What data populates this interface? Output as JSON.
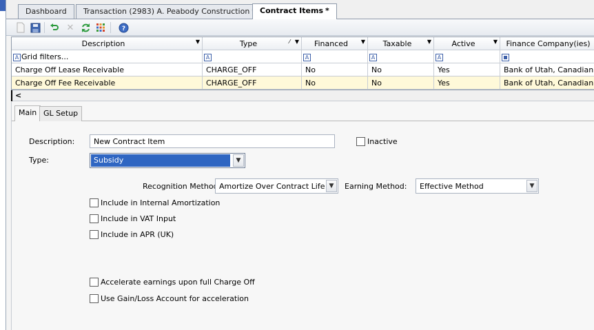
{
  "tabs": [
    {
      "label": "Dashboard",
      "dirty": ""
    },
    {
      "label": "Transaction (2983) A. Peabody Construction",
      "dirty": "*"
    },
    {
      "label": "Contract Items",
      "dirty": "*"
    }
  ],
  "toolbar": {
    "buttons": [
      "new-icon",
      "save-icon",
      "undo-icon",
      "delete-icon",
      "refresh-icon",
      "grid-icon",
      "help-icon"
    ]
  },
  "grid": {
    "columns": [
      "Description",
      "Type",
      "Financed",
      "Taxable",
      "Active",
      "Finance Company(ies)"
    ],
    "filter_placeholder": "Grid filters...",
    "rows": [
      [
        "Charge Off Lease Receivable",
        "CHARGE_OFF",
        "No",
        "No",
        "Yes",
        "Bank of Utah, Canadian Co"
      ],
      [
        "Charge Off Fee Receivable",
        "CHARGE_OFF",
        "No",
        "No",
        "Yes",
        "Bank of Utah, Canadian Co"
      ]
    ],
    "scroll_left": "<"
  },
  "form": {
    "tabs": [
      "Main",
      "GL Setup"
    ],
    "description_label": "Description:",
    "description_value": "New Contract Item",
    "inactive_label": "Inactive",
    "type_label": "Type:",
    "type_value": "Subsidy",
    "recognition_label": "Recognition Method:",
    "recognition_value": "Amortize Over Contract Life",
    "earning_label": "Earning Method:",
    "earning_value": "Effective Method",
    "checkboxes": [
      "Include in Internal Amortization",
      "Include in VAT Input",
      "Include in APR (UK)",
      "Accelerate earnings upon full Charge Off",
      "Use Gain/Loss Account for acceleration"
    ]
  },
  "colors": {
    "selected_row": "#fff9d9",
    "focus_blue": "#2f66c2",
    "accent_blue": "#3c5fa8"
  }
}
